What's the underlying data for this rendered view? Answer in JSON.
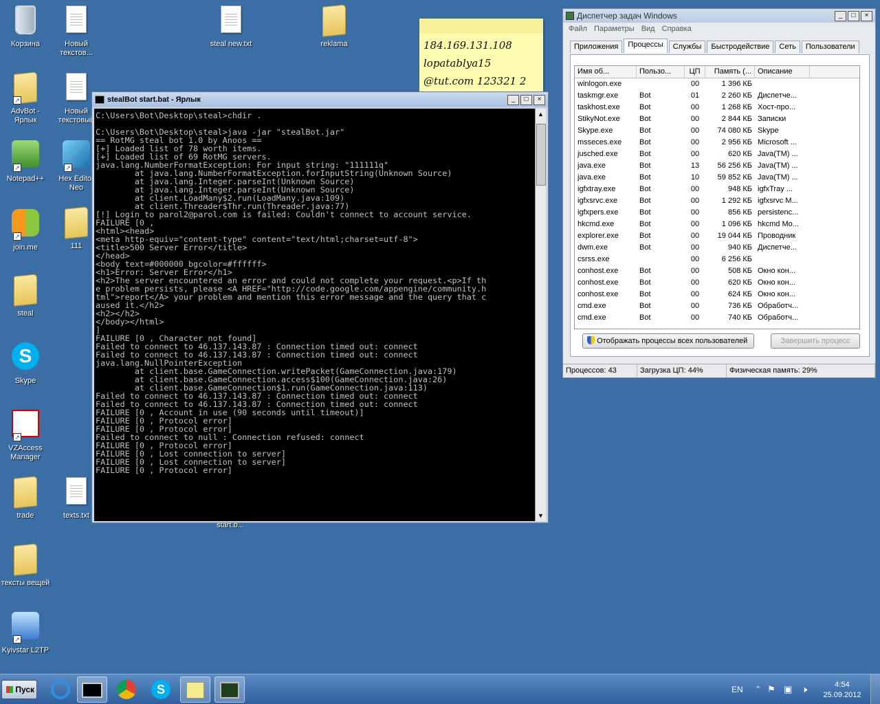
{
  "desktop": {
    "icons": [
      {
        "label": "Корзина"
      },
      {
        "label": "Новый текстов..."
      },
      {
        "label": "steal new.txt"
      },
      {
        "label": "reklama"
      },
      {
        "label": "AdvBot - Ярлык"
      },
      {
        "label": "Новый текстовый"
      },
      {
        "label": "Notepad++"
      },
      {
        "label": "Hex Editor Neo"
      },
      {
        "label": "join.me"
      },
      {
        "label": "111"
      },
      {
        "label": "steal"
      },
      {
        "label": "Skype"
      },
      {
        "label": "VZAccess Manager"
      },
      {
        "label": "trade"
      },
      {
        "label": "texts.txt"
      },
      {
        "label": "start.b..."
      },
      {
        "label": "тексты вещей"
      },
      {
        "label": "Kyivstar L2TP"
      }
    ]
  },
  "note": {
    "lines": [
      "184.169.131.108",
      "lopatablya15",
      "@tut.com 123321 2"
    ]
  },
  "console": {
    "title": "stealBot start.bat - Ярлык",
    "minimize": "_",
    "maximize": "□",
    "close": "×",
    "output": "C:\\Users\\Bot\\Desktop\\steal>chdir .\n\nC:\\Users\\Bot\\Desktop\\steal>java -jar \"stealBot.jar\"\n== RotMG steal bot 1.0 by Anoos ==\n[+] Loaded list of 78 worth items.\n[+] Loaded list of 69 RotMG servers.\njava.lang.NumberFormatException: For input string: \"111111q\"\n        at java.lang.NumberFormatException.forInputString(Unknown Source)\n        at java.lang.Integer.parseInt(Unknown Source)\n        at java.lang.Integer.parseInt(Unknown Source)\n        at client.LoadMany$2.run(LoadMany.java:109)\n        at client.Threader$Thr.run(Threader.java:77)\n[!] Login to parol2@parol.com is failed: Couldn't connect to account service.\nFAILURE [0 ,\n<html><head>\n<meta http-equiv=\"content-type\" content=\"text/html;charset=utf-8\">\n<title>500 Server Error</title>\n</head>\n<body text=#000000 bgcolor=#ffffff>\n<h1>Error: Server Error</h1>\n<h2>The server encountered an error and could not complete your request.<p>If th\ne problem persists, please <A HREF=\"http://code.google.com/appengine/community.h\ntml\">report</A> your problem and mention this error message and the query that c\naused it.</h2>\n<h2></h2>\n</body></html>\n]\nFAILURE [0 , Character not found]\nFailed to connect to 46.137.143.87 : Connection timed out: connect\nFailed to connect to 46.137.143.87 : Connection timed out: connect\njava.lang.NullPointerException\n        at client.base.GameConnection.writePacket(GameConnection.java:179)\n        at client.base.GameConnection.access$100(GameConnection.java:26)\n        at client.base.GameConnection$1.run(GameConnection.java:113)\nFailed to connect to 46.137.143.87 : Connection timed out: connect\nFailed to connect to 46.137.143.87 : Connection timed out: connect\nFAILURE [0 , Account in use (90 seconds until timeout)]\nFAILURE [0 , Protocol error]\nFAILURE [0 , Protocol error]\nFailed to connect to null : Connection refused: connect\nFAILURE [0 , Protocol error]\nFAILURE [0 , Lost connection to server]\nFAILURE [0 , Lost connection to server]\nFAILURE [0 , Protocol error]"
  },
  "taskmgr": {
    "title": "Диспетчер задач Windows",
    "menu": [
      "Файл",
      "Параметры",
      "Вид",
      "Справка"
    ],
    "tabs": [
      "Приложения",
      "Процессы",
      "Службы",
      "Быстродействие",
      "Сеть",
      "Пользователи"
    ],
    "active_tab": "Процессы",
    "columns": [
      "Имя об...",
      "Пользо...",
      "ЦП",
      "Память (...",
      "Описание"
    ],
    "rows": [
      [
        "winlogon.exe",
        "",
        "00",
        "1 396 КБ",
        ""
      ],
      [
        "taskmgr.exe",
        "Bot",
        "01",
        "2 260 КБ",
        "Диспетче..."
      ],
      [
        "taskhost.exe",
        "Bot",
        "00",
        "1 268 КБ",
        "Хост-про..."
      ],
      [
        "StikyNot.exe",
        "Bot",
        "00",
        "2 844 КБ",
        "Записки"
      ],
      [
        "Skype.exe",
        "Bot",
        "00",
        "74 080 КБ",
        "Skype"
      ],
      [
        "msseces.exe",
        "Bot",
        "00",
        "2 956 КБ",
        "Microsoft ..."
      ],
      [
        "jusched.exe",
        "Bot",
        "00",
        "620 КБ",
        "Java(TM) ..."
      ],
      [
        "java.exe",
        "Bot",
        "13",
        "56 256 КБ",
        "Java(TM) ..."
      ],
      [
        "java.exe",
        "Bot",
        "10",
        "59 852 КБ",
        "Java(TM) ..."
      ],
      [
        "igfxtray.exe",
        "Bot",
        "00",
        "948 КБ",
        "igfxTray ..."
      ],
      [
        "igfxsrvc.exe",
        "Bot",
        "00",
        "1 292 КБ",
        "igfxsrvc M..."
      ],
      [
        "igfxpers.exe",
        "Bot",
        "00",
        "856 КБ",
        "persistenc..."
      ],
      [
        "hkcmd.exe",
        "Bot",
        "00",
        "1 096 КБ",
        "hkcmd Mo..."
      ],
      [
        "explorer.exe",
        "Bot",
        "00",
        "19 044 КБ",
        "Проводник"
      ],
      [
        "dwm.exe",
        "Bot",
        "00",
        "940 КБ",
        "Диспетче..."
      ],
      [
        "csrss.exe",
        "",
        "00",
        "6 256 КБ",
        ""
      ],
      [
        "conhost.exe",
        "Bot",
        "00",
        "508 КБ",
        "Окно кон..."
      ],
      [
        "conhost.exe",
        "Bot",
        "00",
        "620 КБ",
        "Окно кон..."
      ],
      [
        "conhost.exe",
        "Bot",
        "00",
        "624 КБ",
        "Окно кон..."
      ],
      [
        "cmd.exe",
        "Bot",
        "00",
        "736 КБ",
        "Обработч..."
      ],
      [
        "cmd.exe",
        "Bot",
        "00",
        "740 КБ",
        "Обработч..."
      ]
    ],
    "show_all_button": "Отображать процессы всех пользователей",
    "end_process_button": "Завершить процесс",
    "status": {
      "processes": "Процессов: 43",
      "cpu": "Загрузка ЦП: 44%",
      "memory": "Физическая память: 29%"
    }
  },
  "taskbar": {
    "start": "Пуск",
    "lang": "EN",
    "time": "4:54",
    "date": "25.09.2012"
  }
}
